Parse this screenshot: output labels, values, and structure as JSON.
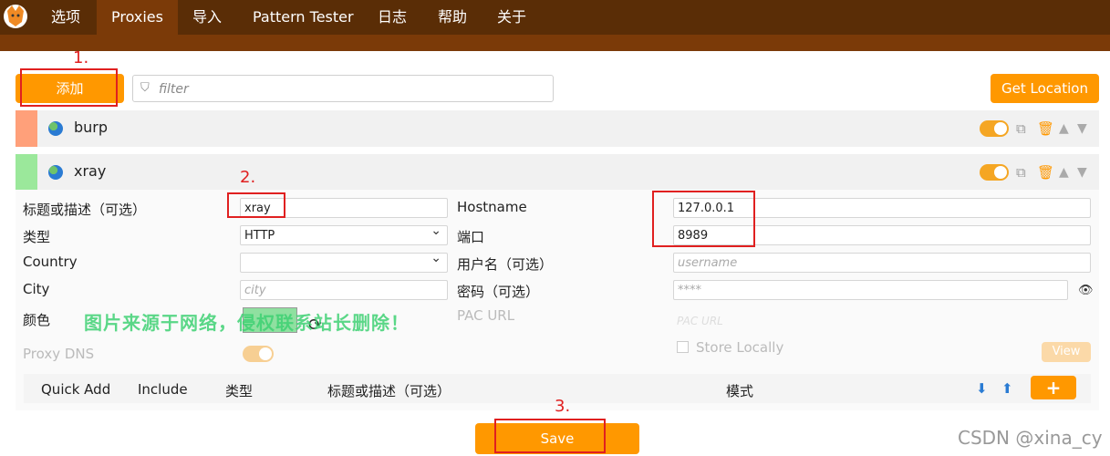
{
  "nav": {
    "items": [
      "选项",
      "Proxies",
      "导入",
      "Pattern Tester",
      "日志",
      "帮助",
      "关于"
    ],
    "active_index": 1
  },
  "toolbar": {
    "add_label": "添加",
    "filter_placeholder": "filter",
    "get_location_label": "Get Location"
  },
  "proxies": [
    {
      "name": "burp",
      "color": "#ffa07a",
      "enabled": true
    },
    {
      "name": "xray",
      "color": "#9be89b",
      "enabled": true
    }
  ],
  "form": {
    "title_label": "标题或描述（可选）",
    "title_value": "xray",
    "type_label": "类型",
    "type_value": "HTTP",
    "country_label": "Country",
    "country_value": "",
    "city_label": "City",
    "city_placeholder": "city",
    "color_label": "颜色",
    "hostname_label": "Hostname",
    "hostname_value": "127.0.0.1",
    "port_label": "端口",
    "port_value": "8989",
    "username_label": "用户名（可选）",
    "username_placeholder": "username",
    "password_label": "密码（可选）",
    "password_placeholder": "****",
    "pac_label": "PAC URL",
    "pac_placeholder": "PAC URL",
    "proxy_dns_label": "Proxy DNS",
    "store_locally_label": "Store Locally",
    "view_label": "View"
  },
  "patterns": {
    "quick_add": "Quick Add",
    "include": "Include",
    "type": "类型",
    "title": "标题或描述（可选）",
    "mode": "模式"
  },
  "save_label": "Save",
  "annotations": {
    "step1": "1.",
    "step2": "2.",
    "step3": "3."
  },
  "watermark": "图片来源于网络，侵权联系站长删除！",
  "credit": "CSDN @xina_cy",
  "colors": {
    "accent": "#ff9800",
    "nav_bg": "#5a2d06",
    "annotation": "#e02020"
  }
}
